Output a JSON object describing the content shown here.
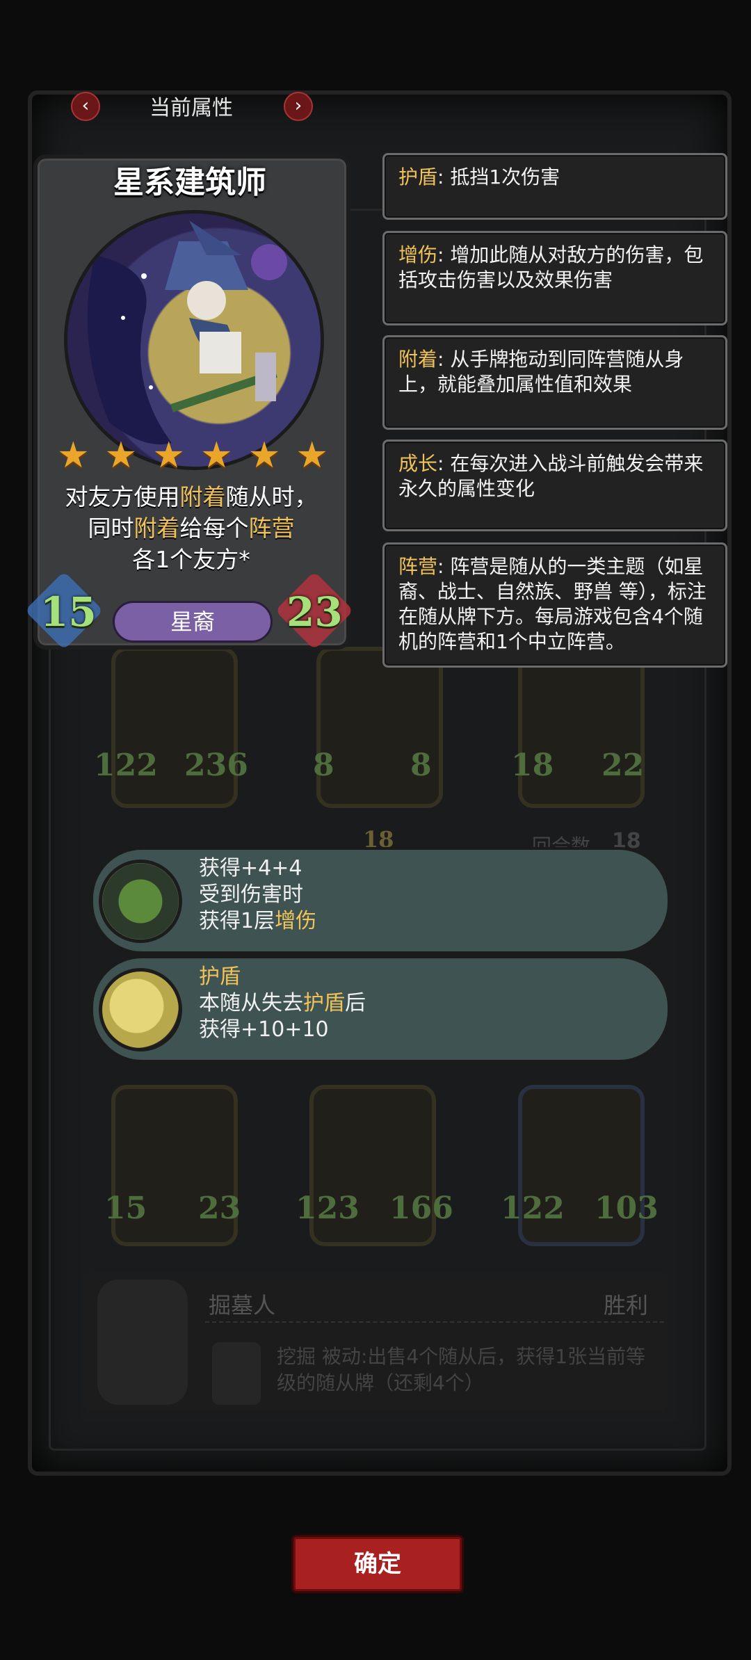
{
  "header": {
    "title": "当前属性",
    "prev_icon": "chevron-left-icon",
    "next_icon": "chevron-right-icon"
  },
  "card": {
    "name": "星系建筑师",
    "stars": 6,
    "text_line1_a": "对友方使用",
    "text_line1_kw": "附着",
    "text_line1_b": "随从时，",
    "text_line2_a": "同时",
    "text_line2_kw1": "附着",
    "text_line2_b": "给每个",
    "text_line2_kw2": "阵营",
    "text_line3": "各1个友方*",
    "attack": "15",
    "health": "23",
    "tribe": "星裔"
  },
  "keywords": [
    {
      "name": "护盾",
      "desc": ": 抵挡1次伤害"
    },
    {
      "name": "增伤",
      "desc": ": 增加此随从对敌方的伤害，包括攻击伤害以及效果伤害"
    },
    {
      "name": "附着",
      "desc": ": 从手牌拖动到同阵营随从身上，就能叠加属性值和效果"
    },
    {
      "name": "成长",
      "desc": ": 在每次进入战斗前触发会带来永久的属性变化"
    },
    {
      "name": "阵营",
      "desc": ": 阵营是随从的一类主题（如星裔、战士、自然族、野兽 等），标注在随从牌下方。每局游戏包含4个随机的阵营和1个中立阵营。"
    }
  ],
  "background_minions_top": [
    {
      "attack": "122",
      "health": "236"
    },
    {
      "attack": "8",
      "health": "8"
    },
    {
      "attack": "18",
      "health": "22"
    }
  ],
  "background_minions_bottom": [
    {
      "attack": "15",
      "health": "23"
    },
    {
      "attack": "123",
      "health": "166"
    },
    {
      "attack": "122",
      "health": "103"
    }
  ],
  "background_misc": {
    "tier": "18",
    "round_label": "回合数",
    "round_value": "18"
  },
  "buffs": [
    {
      "icon": "green-serpent-icon",
      "line1": "获得+4+4",
      "line2": "受到伤害时",
      "line3_a": "获得1层",
      "line3_kw": "增伤"
    },
    {
      "icon": "moon-wolf-icon",
      "line1": "护盾",
      "line2_a": "本随从失去",
      "line2_kw": "护盾",
      "line2_b": "后",
      "line3": "获得+10+10"
    }
  ],
  "hero": {
    "name": "掘墓人",
    "status": "胜利",
    "ability_name": "挖掘",
    "ability_type": "被动",
    "ability_text": ":出售4个随从后，获得1张当前等级的随从牌（还剩4个）"
  },
  "confirm_label": "确定",
  "colors": {
    "keyword": "#f0c35a",
    "stat_green": "#a6e07a",
    "buff_bg": "#3f5452",
    "confirm_red": "#a82020",
    "tribe_purple": "#7c60a6"
  }
}
